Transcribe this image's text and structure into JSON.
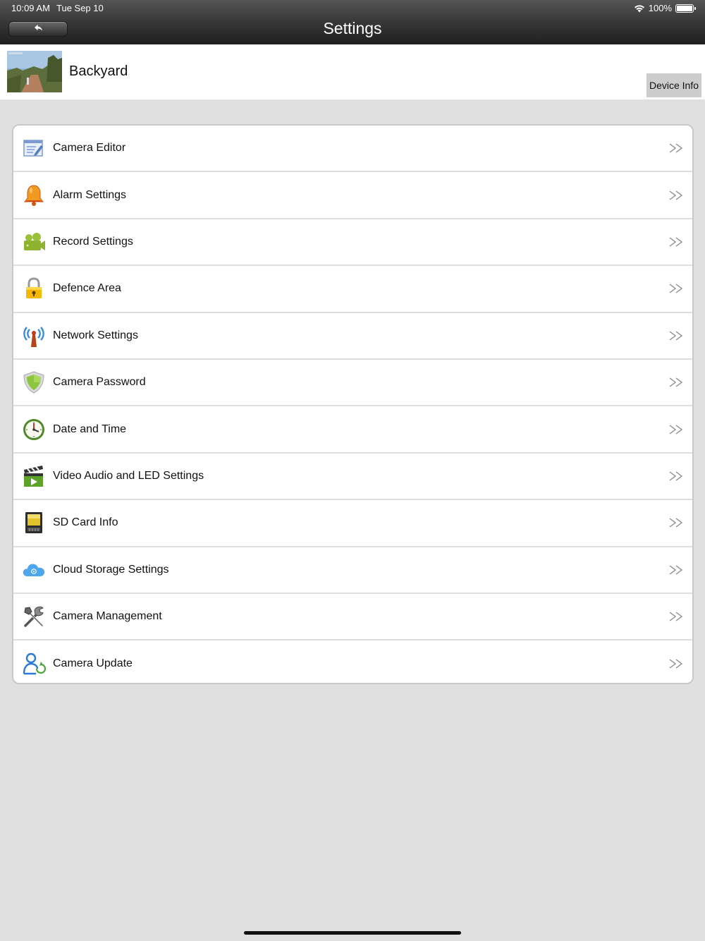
{
  "status_bar": {
    "time": "10:09 AM",
    "date": "Tue Sep 10",
    "battery_text": "100%"
  },
  "nav": {
    "title": "Settings",
    "back_icon": "back-arrow-icon"
  },
  "device": {
    "name": "Backyard",
    "info_button": "Device Info"
  },
  "menu": {
    "items": [
      {
        "label": "Camera Editor",
        "icon": "camera-editor-icon"
      },
      {
        "label": "Alarm Settings",
        "icon": "bell-icon"
      },
      {
        "label": "Record Settings",
        "icon": "video-camera-icon"
      },
      {
        "label": "Defence Area",
        "icon": "lock-icon"
      },
      {
        "label": "Network Settings",
        "icon": "antenna-icon"
      },
      {
        "label": "Camera Password",
        "icon": "shield-icon"
      },
      {
        "label": "Date and Time",
        "icon": "clock-icon"
      },
      {
        "label": "Video Audio and LED Settings",
        "icon": "clapperboard-icon"
      },
      {
        "label": "SD Card Info",
        "icon": "sd-card-icon"
      },
      {
        "label": "Cloud Storage Settings",
        "icon": "cloud-icon"
      },
      {
        "label": "Camera Management",
        "icon": "tools-icon"
      },
      {
        "label": "Camera Update",
        "icon": "user-update-icon"
      }
    ],
    "chevron_icon": "double-chevron-right-icon"
  },
  "colors": {
    "nav_bar": "#2a2a2a",
    "background": "#e0e0e0",
    "card": "#ffffff",
    "device_info_button": "#cdcdcd"
  }
}
